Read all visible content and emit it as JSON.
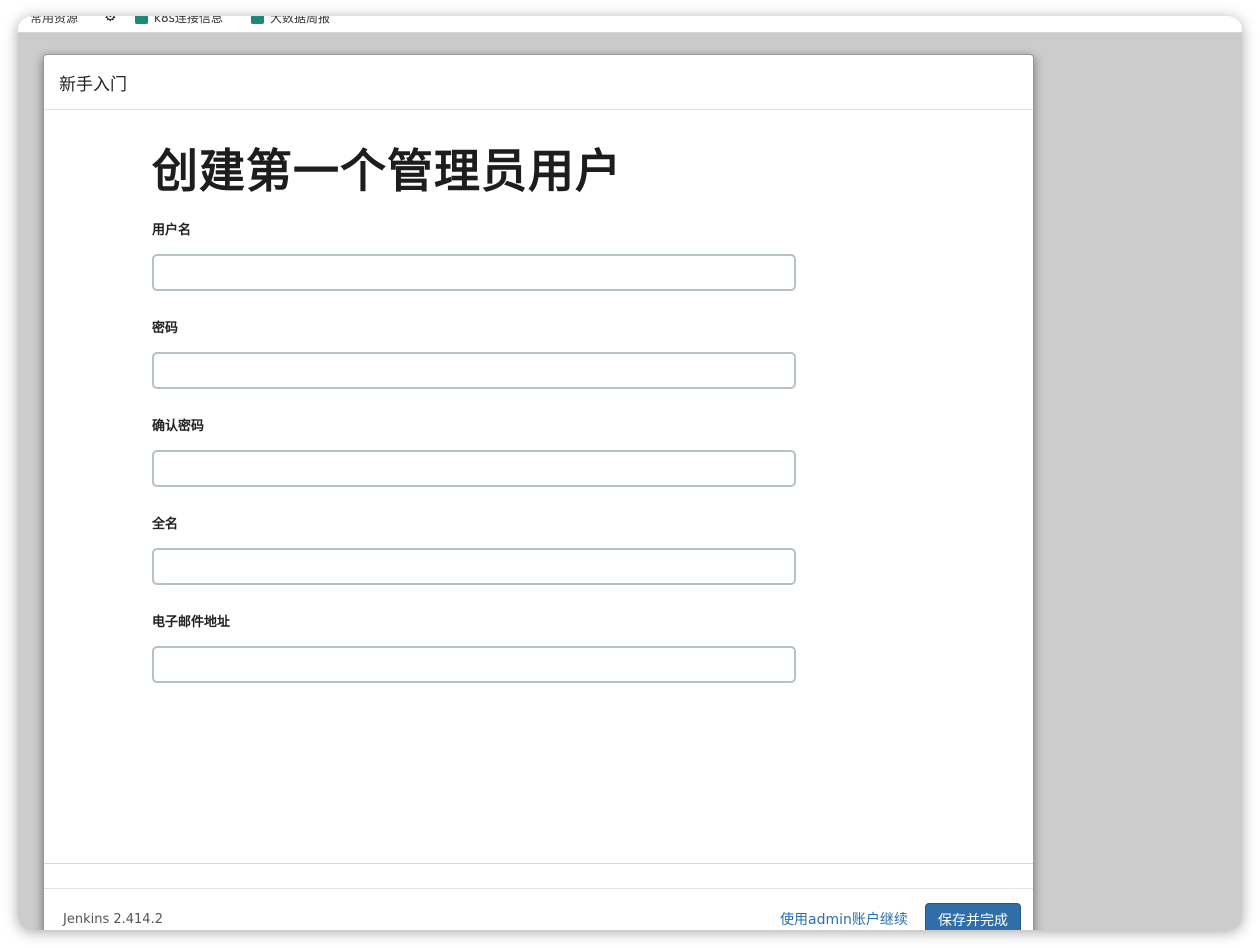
{
  "bookmarks": [
    {
      "label": "常用资源",
      "icon": "none"
    },
    {
      "label": "",
      "icon": "gear-icon"
    },
    {
      "label": "k8s连接信息",
      "icon": "folder-icon"
    },
    {
      "label": "大数据周报",
      "icon": "folder-icon"
    }
  ],
  "dialog": {
    "header_title": "新手入门",
    "page_title": "创建第一个管理员用户",
    "fields": [
      {
        "label": "用户名",
        "value": "",
        "type": "text"
      },
      {
        "label": "密码",
        "value": "",
        "type": "password"
      },
      {
        "label": "确认密码",
        "value": "",
        "type": "password"
      },
      {
        "label": "全名",
        "value": "",
        "type": "text"
      },
      {
        "label": "电子邮件地址",
        "value": "",
        "type": "email"
      }
    ],
    "footer": {
      "version": "Jenkins 2.414.2",
      "continue_admin_label": "使用admin账户继续",
      "save_label": "保存并完成"
    }
  },
  "colors": {
    "primary_button": "#2f6ea9",
    "link": "#2a6fb0",
    "input_border": "#b5c2c6",
    "backdrop": "#cccccc"
  }
}
